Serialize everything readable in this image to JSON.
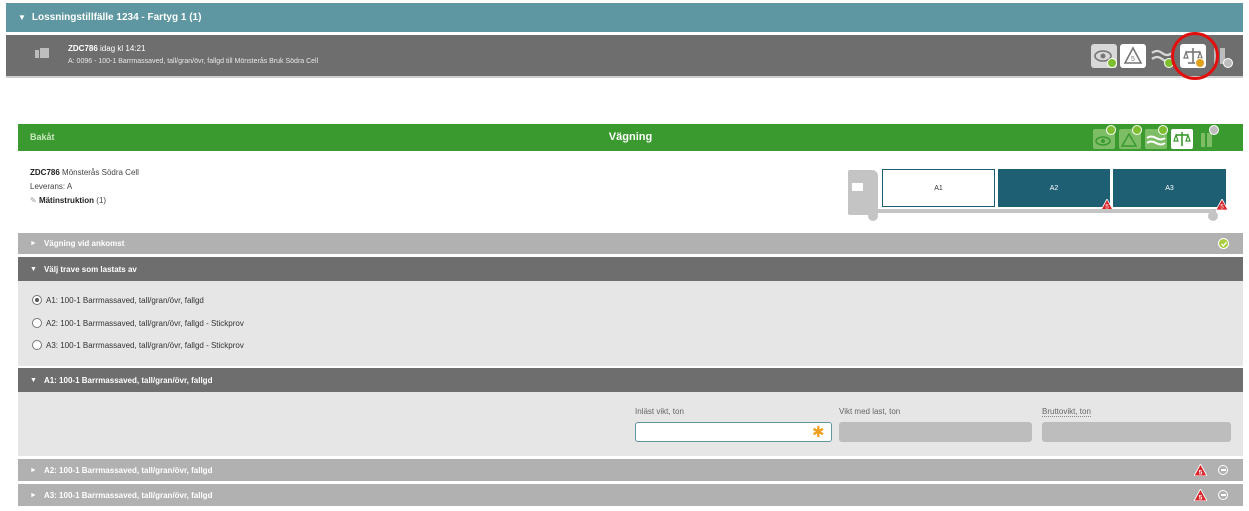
{
  "session": {
    "title": "Lossningstillfälle 1234 - Fartyg 1 (1)",
    "triangle": "▼"
  },
  "transport": {
    "vehicle": "ZDC786",
    "time": "idag kl 14:21",
    "description": "A: 0096 - 100-1 Barrmassaved, tall/gran/övr, fallgd till Mönsterås Bruk Södra Cell",
    "status_icons": [
      {
        "name": "eye-icon",
        "status": "ok"
      },
      {
        "name": "warning-icon",
        "status": "ok"
      },
      {
        "name": "moisture-icon",
        "status": "ok"
      },
      {
        "name": "scale-icon",
        "status": "warning"
      },
      {
        "name": "unload-icon",
        "status": "neutral"
      }
    ]
  },
  "action_bar": {
    "back_label": "Bakåt",
    "title": "Vägning",
    "color": "#3a9a2f"
  },
  "info": {
    "vehicle": "ZDC786",
    "destination": "Mönsterås Södra Cell",
    "delivery": "Leverans: A",
    "instruction_label": "Mätinstruktion",
    "instruction_count": "(1)"
  },
  "truck": {
    "bays": [
      "A1",
      "A2",
      "A3"
    ],
    "selected_bay": "A1"
  },
  "sections": {
    "arrival": {
      "label": "Vägning vid ankomst",
      "triangle": "►"
    },
    "choose_pile": {
      "label": "Välj trave som lastats av",
      "triangle": "▼",
      "options": [
        "A1: 100-1 Barrmassaved, tall/gran/övr, fallgd",
        "A2: 100-1 Barrmassaved, tall/gran/övr, fallgd - Stickprov",
        "A3: 100-1 Barrmassaved, tall/gran/övr, fallgd - Stickprov"
      ],
      "selected_index": 0
    },
    "a1": {
      "label": "A1: 100-1 Barrmassaved, tall/gran/övr, fallgd",
      "triangle": "▼",
      "fields": {
        "read_weight_label": "Inläst vikt, ton",
        "read_weight_value": "",
        "required_mark": "✱",
        "loaded_weight_label": "Vikt med last, ton",
        "gross_weight_label": "Bruttovikt, ton"
      }
    },
    "a2": {
      "label": "A2: 100-1 Barrmassaved, tall/gran/övr, fallgd",
      "triangle": "►"
    },
    "a3": {
      "label": "A3: 100-1 Barrmassaved, tall/gran/övr, fallgd",
      "triangle": "►"
    }
  },
  "colors": {
    "teal": "#5e97a1",
    "dark_teal": "#1f5f74",
    "warning_red": "#d9262c",
    "ok_green": "#a9cf3e"
  }
}
